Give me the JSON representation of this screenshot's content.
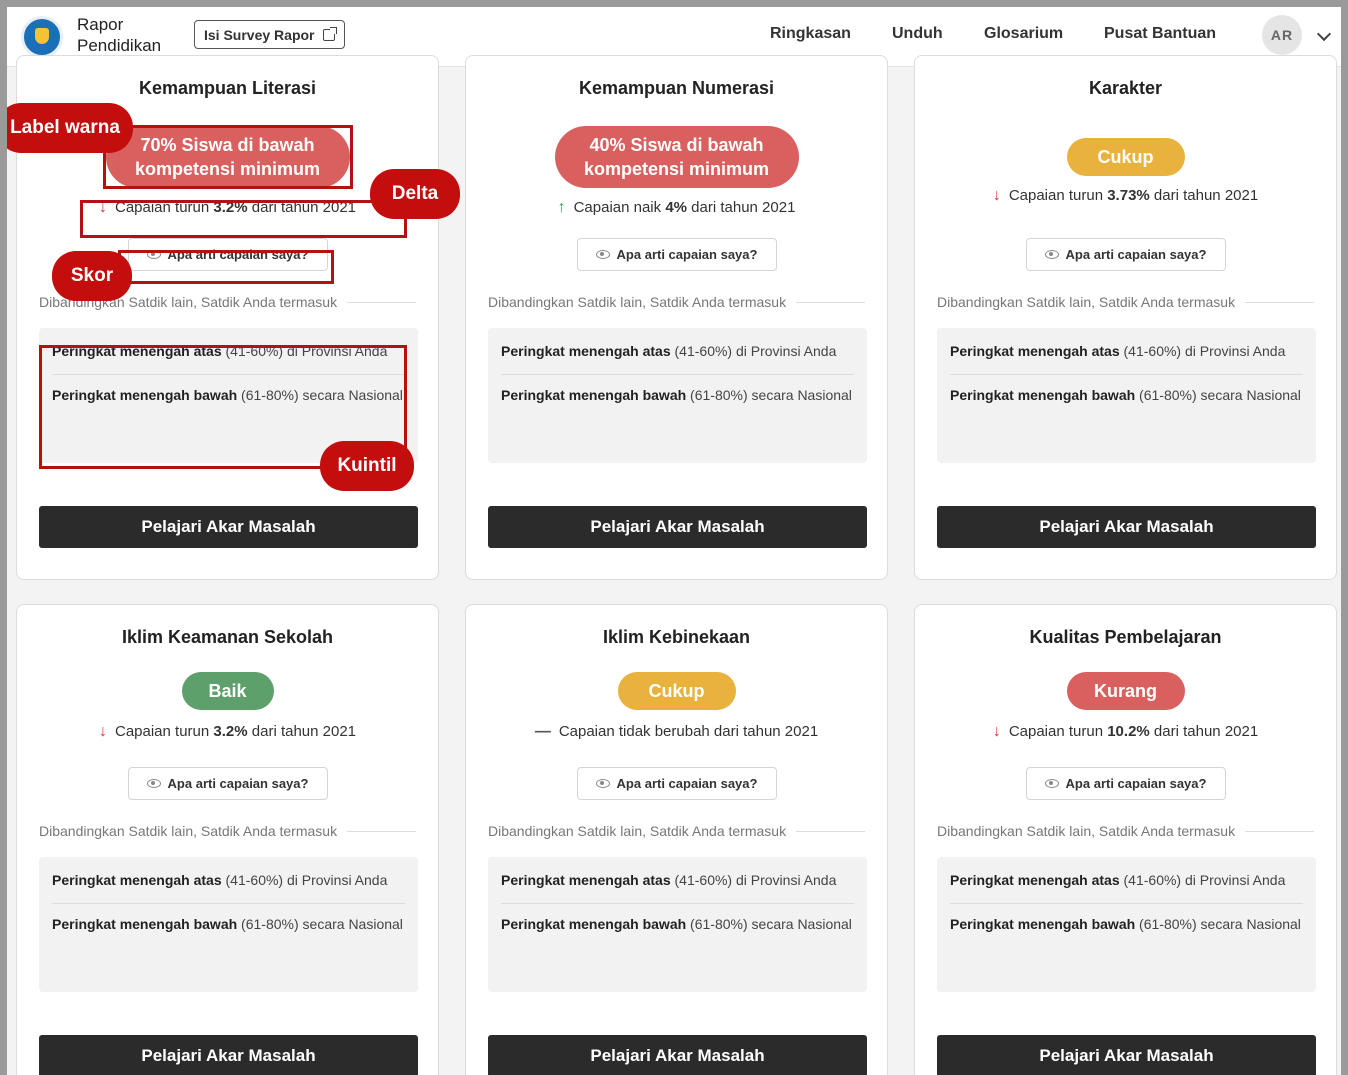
{
  "header": {
    "brand_line1": "Rapor",
    "brand_line2": "Pendidikan",
    "survey_button": "Isi Survey Rapor",
    "nav": [
      "Ringkasan",
      "Unduh",
      "Glosarium",
      "Pusat Bantuan"
    ],
    "active_nav": "Ringkasan",
    "avatar_initials": "AR",
    "accent_color": "#2c6fd1"
  },
  "common": {
    "skor_button": "Apa arti capaian saya?",
    "compare_label": "Dibandingkan Satdik lain, Satdik Anda termasuk",
    "cta": "Pelajari Akar Masalah",
    "q1_strong": "Peringkat menengah atas",
    "q1_rest": " (41-60%) di Provinsi Anda",
    "q2_strong": "Peringkat menengah bawah",
    "q2_rest": " (61-80%) secara Nasional"
  },
  "cards": [
    {
      "title": "Kemampuan Literasi",
      "label": "70% Siswa di bawah kompetensi minimum",
      "label_color": "#d9605f",
      "delta_dir": "down",
      "delta_pre": "Capaian turun ",
      "delta_val": "3.2%",
      "delta_post": " dari tahun 2021"
    },
    {
      "title": "Kemampuan Numerasi",
      "label": "40% Siswa di bawah kompetensi minimum",
      "label_color": "#d9605f",
      "delta_dir": "up",
      "delta_pre": "Capaian naik ",
      "delta_val": "4%",
      "delta_post": " dari tahun 2021"
    },
    {
      "title": "Karakter",
      "label": "Cukup",
      "label_color": "#e8b23d",
      "delta_dir": "down",
      "delta_pre": "Capaian turun ",
      "delta_val": "3.73%",
      "delta_post": " dari tahun 2021"
    },
    {
      "title": "Iklim Keamanan Sekolah",
      "label": "Baik",
      "label_color": "#5ea06c",
      "delta_dir": "down",
      "delta_pre": "Capaian turun ",
      "delta_val": "3.2%",
      "delta_post": " dari tahun 2021"
    },
    {
      "title": "Iklim Kebinekaan",
      "label": "Cukup",
      "label_color": "#e8b23d",
      "delta_dir": "flat",
      "delta_pre": "Capaian tidak berubah dari tahun 2021",
      "delta_val": "",
      "delta_post": ""
    },
    {
      "title": "Kualitas Pembelajaran",
      "label": "Kurang",
      "label_color": "#d9605f",
      "delta_dir": "down",
      "delta_pre": "Capaian turun ",
      "delta_val": "10.2%",
      "delta_post": " dari tahun 2021"
    }
  ],
  "annotations": {
    "label_warna": "Label warna",
    "delta": "Delta",
    "skor": "Skor",
    "kuintil": "Kuintil",
    "color": "#c40d0d"
  }
}
